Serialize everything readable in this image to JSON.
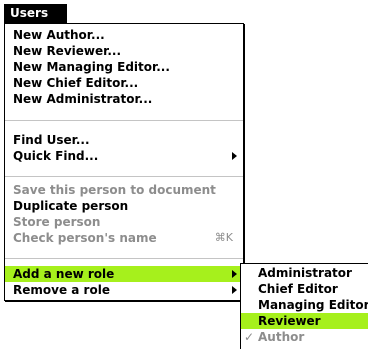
{
  "menu": {
    "title": "Users",
    "items": [
      {
        "label": "New Author..."
      },
      {
        "label": "New Reviewer..."
      },
      {
        "label": "New Managing Editor..."
      },
      {
        "label": "New Chief Editor..."
      },
      {
        "label": "New Administrator..."
      },
      {
        "label": "Find User..."
      },
      {
        "label": "Quick Find..."
      },
      {
        "label": "Save this person to document"
      },
      {
        "label": "Duplicate person"
      },
      {
        "label": "Store person"
      },
      {
        "label": "Check person's name",
        "shortcut": "⌘K"
      },
      {
        "label": "Add a new role"
      },
      {
        "label": "Remove a role"
      }
    ]
  },
  "submenu": {
    "items": [
      {
        "label": "Administrator"
      },
      {
        "label": "Chief Editor"
      },
      {
        "label": "Managing Editor"
      },
      {
        "label": "Reviewer"
      },
      {
        "label": "Author",
        "check": "✓"
      }
    ]
  },
  "colors": {
    "highlight": "#a6f01c",
    "disabled_text": "#8d8d8d",
    "menu_title_bg": "#000000"
  },
  "icons": {
    "submenu_arrow": "triangle-right-icon",
    "checkmark": "checkmark-icon"
  }
}
